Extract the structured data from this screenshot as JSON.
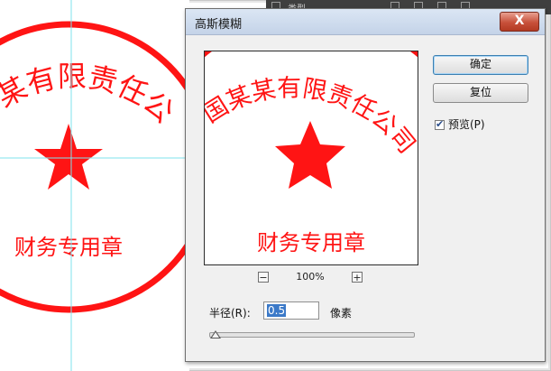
{
  "colors": {
    "stamp_red": "#ff1414",
    "guide_cyan": "#7fe3ec",
    "dialog_bg": "#f0f0f0"
  },
  "topbar": {
    "text": "类型"
  },
  "stamp": {
    "company_text": "某某有限责任公司",
    "canvas_arc_text": "某有限责任公",
    "preview_arc_text": "国某某有限责任公司",
    "bottom_text": "财务专用章"
  },
  "dialog": {
    "title": "高斯模糊",
    "close_label": "X",
    "ok_label": "确定",
    "reset_label": "复位",
    "preview_label": "预览(P)",
    "preview_checked": true,
    "zoom": {
      "minus_label": "−",
      "value": "100%",
      "plus_label": "+"
    },
    "radius": {
      "label": "半径(R):",
      "value": "0.5",
      "unit": "像素"
    },
    "slider": {
      "fraction": 0.0
    }
  }
}
